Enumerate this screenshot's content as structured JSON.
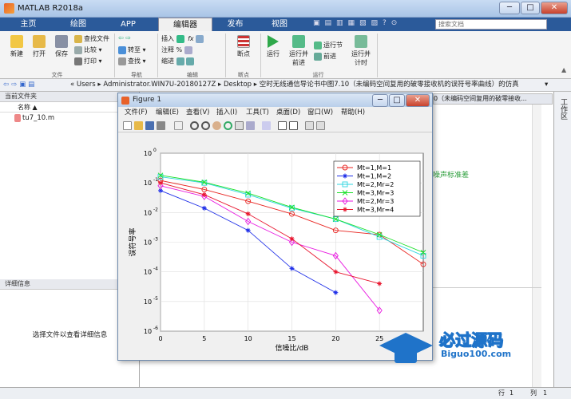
{
  "window": {
    "title": "MATLAB R2018a",
    "min": "─",
    "max": "□",
    "close": "✕"
  },
  "tabs": [
    "主页",
    "绘图",
    "APP",
    "编辑器",
    "发布",
    "视图"
  ],
  "search": {
    "placeholder": "搜索文档"
  },
  "ribbon": {
    "file": {
      "new": "新建",
      "open": "打开",
      "save": "保存",
      "find_files": "查找文件",
      "compare": "比较",
      "print": "打印",
      "group": "文件"
    },
    "nav": {
      "goto": "转至",
      "find": "查找",
      "group": "导航"
    },
    "edit": {
      "insert": "插入",
      "comment": "注释",
      "indent": "缩进",
      "group": "编辑"
    },
    "breakpoints": {
      "label": "断点",
      "group": "断点"
    },
    "run": {
      "run": "运行",
      "run_advance": "运行并\n前进",
      "run_section": "运行节",
      "advance": "前进",
      "run_time": "运行并\n计时",
      "group": "运行"
    }
  },
  "path": {
    "parts": [
      "Users",
      "Administrator.WIN7U-20180127Z",
      "Desktop",
      "空时无线通信导论书中图7.10（未编码空间复用的破零接收机的误符号率曲线）的仿真"
    ]
  },
  "leftpanel": {
    "title": "当前文件夹",
    "col_name": "名称",
    "file": "tu7_10.m",
    "details_title": "详细信息",
    "details_msg": "选择文件以查看详细信息"
  },
  "editor": {
    "tab_text": "0（未编码空间复用的破零接收...",
    "fragment": "噪声标准差"
  },
  "rightstrip": {
    "label": "工作区"
  },
  "status": {
    "row_label": "行",
    "row": "1",
    "col_label": "列",
    "col": "1"
  },
  "figure": {
    "title": "Figure 1",
    "menu": [
      "文件(F)",
      "编辑(E)",
      "查看(V)",
      "插入(I)",
      "工具(T)",
      "桌面(D)",
      "窗口(W)",
      "帮助(H)"
    ]
  },
  "chart_data": {
    "type": "line",
    "xlabel": "信噪比/dB",
    "ylabel": "误符号率",
    "xlim": [
      0,
      30
    ],
    "ylim": [
      1e-06,
      1
    ],
    "yscale": "log",
    "grid": true,
    "legend_position": "top-right",
    "xticks": [
      0,
      5,
      10,
      15,
      20,
      25
    ],
    "yticks_exp": [
      0,
      -1,
      -2,
      -3,
      -4,
      -5,
      -6
    ],
    "series": [
      {
        "name": "Mt=1,M=1",
        "color": "#e8231f",
        "marker": "o",
        "x": [
          0,
          5,
          10,
          15,
          20,
          25,
          30
        ],
        "y": [
          0.12,
          0.06,
          0.024,
          0.009,
          0.0025,
          0.0018,
          0.00018
        ]
      },
      {
        "name": "Mt=1,M=2",
        "color": "#1f2fe8",
        "marker": "*",
        "x": [
          0,
          5,
          10,
          15,
          20
        ],
        "y": [
          0.055,
          0.014,
          0.0025,
          0.00013,
          2e-05
        ]
      },
      {
        "name": "Mt=2,Mr=2",
        "color": "#2fd6e0",
        "marker": "s",
        "x": [
          0,
          5,
          10,
          15,
          20,
          25,
          30
        ],
        "y": [
          0.16,
          0.1,
          0.04,
          0.014,
          0.006,
          0.0015,
          0.00035
        ]
      },
      {
        "name": "Mt=3,Mr=3",
        "color": "#19e028",
        "marker": "x",
        "x": [
          0,
          5,
          10,
          15,
          20,
          25,
          30
        ],
        "y": [
          0.18,
          0.105,
          0.045,
          0.015,
          0.006,
          0.0018,
          0.00045
        ]
      },
      {
        "name": "Mt=2,Mr=3",
        "color": "#e818e0",
        "marker": "d",
        "x": [
          0,
          5,
          10,
          15,
          20,
          25
        ],
        "y": [
          0.08,
          0.035,
          0.005,
          0.001,
          0.00035,
          5e-06
        ]
      },
      {
        "name": "Mt=3,Mr=4",
        "color": "#e81830",
        "marker": "*",
        "x": [
          0,
          5,
          10,
          15,
          20,
          25
        ],
        "y": [
          0.1,
          0.04,
          0.009,
          0.0013,
          0.0001,
          4e-05
        ]
      }
    ]
  },
  "watermark": {
    "title": "必过源码",
    "url": "Biguo100.com"
  }
}
